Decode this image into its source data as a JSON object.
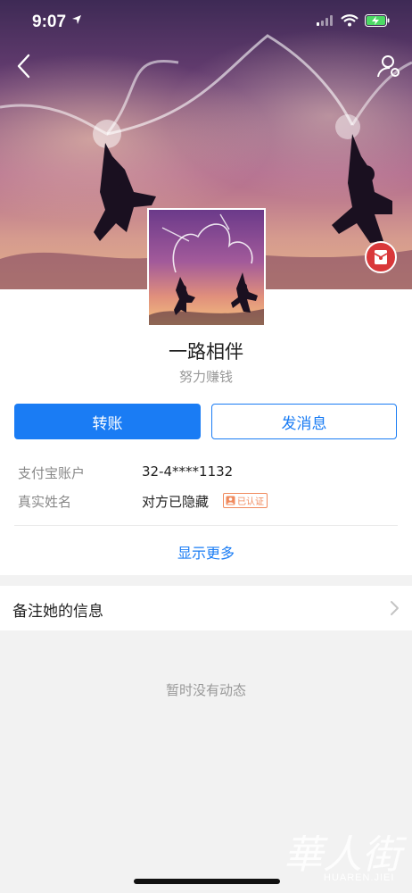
{
  "status_bar": {
    "time": "9:07"
  },
  "profile": {
    "name": "一路相伴",
    "signature": "努力赚钱"
  },
  "actions": {
    "transfer_label": "转账",
    "message_label": "发消息"
  },
  "info": {
    "account_label": "支付宝账户",
    "account_value": "32-4****1132",
    "realname_label": "真实姓名",
    "realname_value": "对方已隐藏",
    "verified_badge": "已认证"
  },
  "show_more_label": "显示更多",
  "remark": {
    "label": "备注她的信息"
  },
  "feed": {
    "empty_text": "暂时没有动态"
  },
  "watermark": {
    "text": "HUAREN.JIEI"
  },
  "colors": {
    "accent": "#1a7cf4",
    "badge": "#f08a5d",
    "red": "#d9383a"
  }
}
